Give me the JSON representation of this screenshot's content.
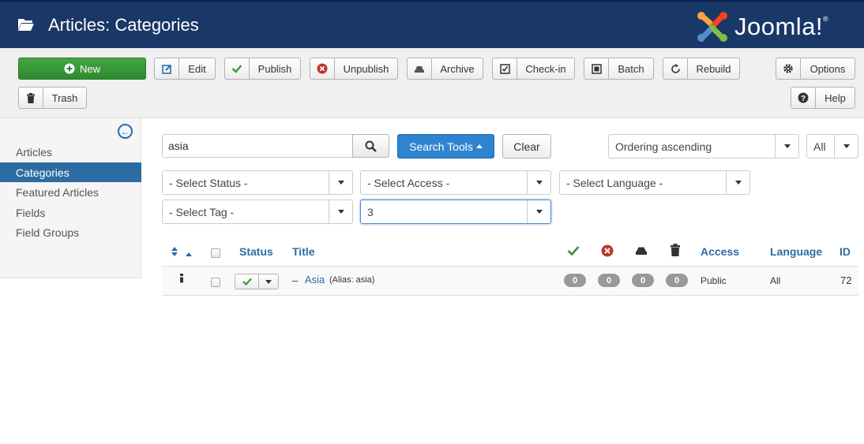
{
  "header": {
    "title": "Articles: Categories",
    "logo_text": "Joomla!",
    "logo_reg": "®"
  },
  "toolbar": {
    "new": "New",
    "edit": "Edit",
    "publish": "Publish",
    "unpublish": "Unpublish",
    "archive": "Archive",
    "checkin": "Check-in",
    "batch": "Batch",
    "rebuild": "Rebuild",
    "options": "Options",
    "trash": "Trash",
    "help": "Help"
  },
  "sidebar": {
    "items": [
      {
        "label": "Articles",
        "active": false
      },
      {
        "label": "Categories",
        "active": true
      },
      {
        "label": "Featured Articles",
        "active": false
      },
      {
        "label": "Fields",
        "active": false
      },
      {
        "label": "Field Groups",
        "active": false
      }
    ]
  },
  "filters": {
    "search_value": "asia",
    "search_tools": "Search Tools",
    "clear": "Clear",
    "ordering": "Ordering ascending",
    "limit": "All",
    "status": "- Select Status -",
    "access": "- Select Access -",
    "language": "- Select Language -",
    "tag": "- Select Tag -",
    "level": "3"
  },
  "table": {
    "headers": {
      "status": "Status",
      "title": "Title",
      "access": "Access",
      "language": "Language",
      "id": "ID"
    },
    "rows": [
      {
        "prefix": "–",
        "title": "Asia",
        "alias": "(Alias: asia)",
        "published": "0",
        "unpublished": "0",
        "archived": "0",
        "trashed": "0",
        "access": "Public",
        "language": "All",
        "id": "72"
      }
    ]
  },
  "colors": {
    "header_bg": "#1a3867",
    "primary": "#2f84d0",
    "success": "#2f8a2f",
    "link": "#2d6ca2"
  }
}
